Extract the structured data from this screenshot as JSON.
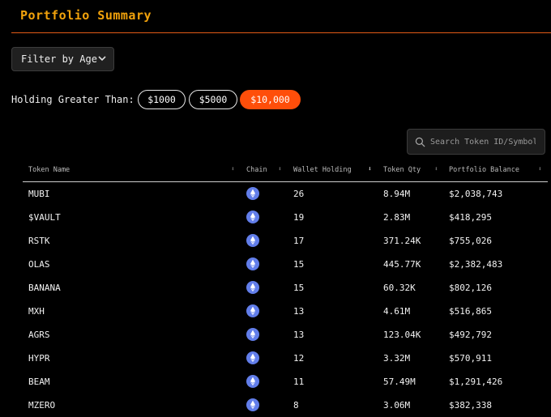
{
  "header": {
    "title": "Portfolio Summary"
  },
  "filter": {
    "label": "Filter by Age"
  },
  "holding": {
    "label": "Holding Greater Than:",
    "options": [
      "$1000",
      "$5000",
      "$10,000"
    ],
    "selected": "$10,000"
  },
  "search": {
    "placeholder": "Search Token ID/Symbol"
  },
  "table": {
    "columns": [
      "Token Name",
      "Chain",
      "Wallet Holding",
      "Token Qty",
      "Portfolio Balance"
    ],
    "sorted_column": "Wallet Holding",
    "rows": [
      {
        "name": "MUBI",
        "chain": "ethereum",
        "holding": "26",
        "qty": "8.94M",
        "balance": "$2,038,743"
      },
      {
        "name": "$VAULT",
        "chain": "ethereum",
        "holding": "19",
        "qty": "2.83M",
        "balance": "$418,295"
      },
      {
        "name": "RSTK",
        "chain": "ethereum",
        "holding": "17",
        "qty": "371.24K",
        "balance": "$755,026"
      },
      {
        "name": "OLAS",
        "chain": "ethereum",
        "holding": "15",
        "qty": "445.77K",
        "balance": "$2,382,483"
      },
      {
        "name": "BANANA",
        "chain": "ethereum",
        "holding": "15",
        "qty": "60.32K",
        "balance": "$802,126"
      },
      {
        "name": "MXH",
        "chain": "ethereum",
        "holding": "13",
        "qty": "4.61M",
        "balance": "$516,865"
      },
      {
        "name": "AGRS",
        "chain": "ethereum",
        "holding": "13",
        "qty": "123.04K",
        "balance": "$492,792"
      },
      {
        "name": "HYPR",
        "chain": "ethereum",
        "holding": "12",
        "qty": "3.32M",
        "balance": "$570,911"
      },
      {
        "name": "BEAM",
        "chain": "ethereum",
        "holding": "11",
        "qty": "57.49M",
        "balance": "$1,291,426"
      },
      {
        "name": "MZERO",
        "chain": "ethereum",
        "holding": "8",
        "qty": "3.06M",
        "balance": "$382,338"
      }
    ]
  },
  "colors": {
    "accent": "#ff4e0a",
    "title": "#f2a20b",
    "rule": "#e25a16",
    "chain_icon": "#627eea"
  },
  "icons": {
    "search": "search-icon",
    "filter": "chevron-down-icon",
    "chain": "ethereum-icon"
  }
}
